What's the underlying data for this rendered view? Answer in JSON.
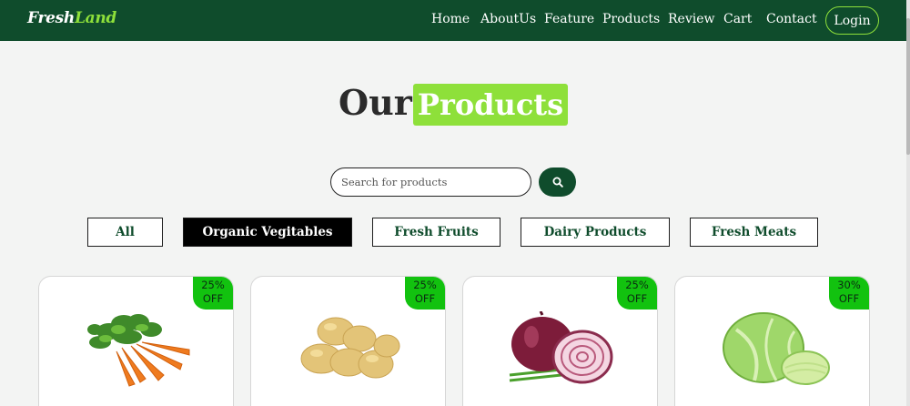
{
  "brand": {
    "name_part1": "Fresh",
    "name_part2": "Land"
  },
  "nav": {
    "links": [
      "Home",
      "AboutUs",
      "Feature",
      "Products",
      "Review",
      "Cart",
      "Contact"
    ],
    "login_label": "Login"
  },
  "section": {
    "title_part1": "Our",
    "title_part2": "Products"
  },
  "search": {
    "placeholder": "Search for products",
    "button_icon": "search-icon"
  },
  "filters": [
    {
      "label": "All",
      "active": false
    },
    {
      "label": "Organic Vegitables",
      "active": true
    },
    {
      "label": "Fresh Fruits",
      "active": false
    },
    {
      "label": "Dairy Products",
      "active": false
    },
    {
      "label": "Fresh Meats",
      "active": false
    }
  ],
  "products": [
    {
      "image": "carrot-image",
      "discount_value": "25%",
      "discount_label": "OFF"
    },
    {
      "image": "potato-image",
      "discount_value": "25%",
      "discount_label": "OFF"
    },
    {
      "image": "onion-image",
      "discount_value": "25%",
      "discount_label": "OFF"
    },
    {
      "image": "cabbage-image",
      "discount_value": "30%",
      "discount_label": "OFF"
    }
  ],
  "colors": {
    "nav_bg": "#0f4c2c",
    "accent": "#8ee03a",
    "badge": "#12c20f",
    "page_bg": "#f3f4f3"
  }
}
